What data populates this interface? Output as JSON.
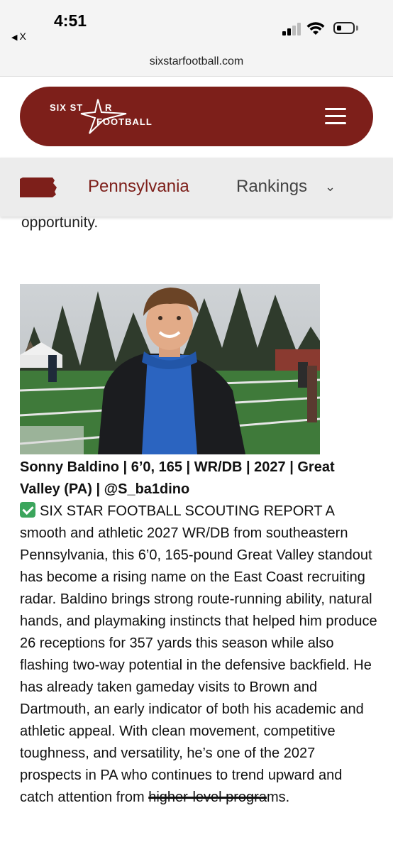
{
  "status_bar": {
    "time": "4:51",
    "back_app": "X",
    "icons": [
      "signal-icon",
      "wifi-icon",
      "battery-icon"
    ]
  },
  "browser": {
    "url": "sixstarfootball.com"
  },
  "header": {
    "logo_line1": "SIX ST",
    "logo_line1b": "R",
    "logo_line2": "FOOTBALL",
    "menu_icon": "hamburger-menu-icon",
    "bg_color": "#7d1f1a"
  },
  "subnav": {
    "state": "Pennsylvania",
    "rankings": "Rankings",
    "state_color": "#7d1f1a"
  },
  "article": {
    "prev_text": "opportunity.",
    "headline": "Sonny Baldino | 6’0, 165 | WR/DB | 2027 | Great Valley (PA) | @S_ba1dino",
    "body_main": "SIX STAR FOOTBALL SCOUTING REPORT A smooth and athletic 2027 WR/DB from southeastern Pennsylvania, this 6’0, 165-pound Great Valley standout has become a rising name on the East Coast recruiting radar. Baldino brings strong route-running ability, natural hands, and playmaking instincts that helped him produce 26 receptions for 357 yards this season while also flashing two-way potential in the defensive backfield. He has already taken gameday visits to Brown and Dartmouth, an early indicator of both his academic and athletic appeal. With clean movement, competitive toughness, and versatility, he’s one of the 2027 prospects in PA who continues to trend upward and catch attention from ",
    "body_strike": "higher-level progra",
    "body_end": "ms."
  }
}
